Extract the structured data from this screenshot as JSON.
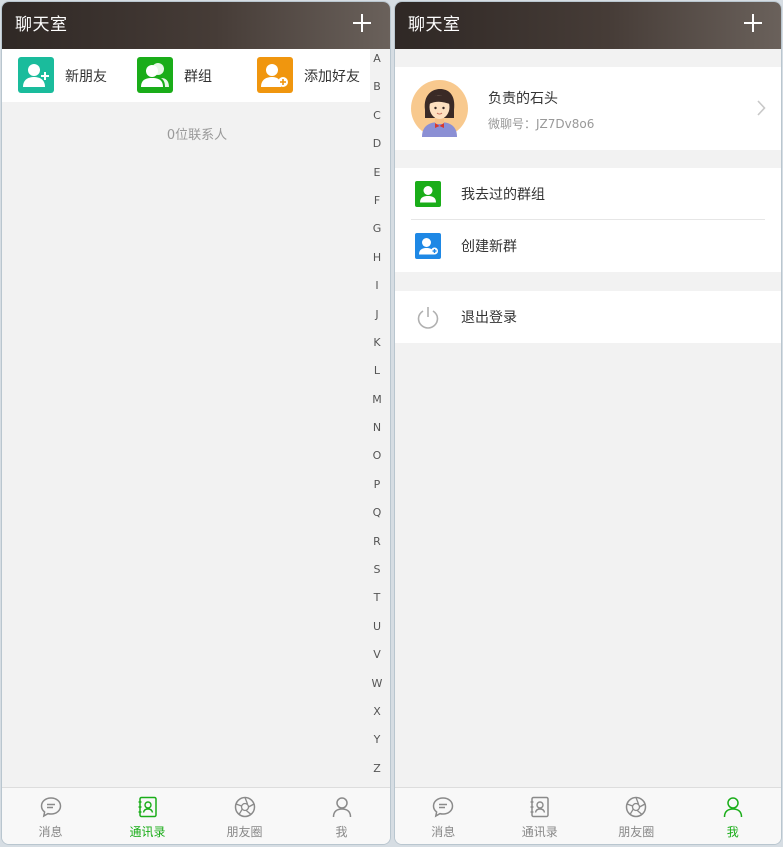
{
  "left": {
    "header": {
      "title": "聊天室"
    },
    "quickbar": {
      "items": [
        {
          "label": "新朋友",
          "color": "#1abc9c",
          "icon": "new-friend-icon"
        },
        {
          "label": "群组",
          "color": "#1aad19",
          "icon": "group-icon"
        },
        {
          "label": "添加好友",
          "color": "#f0960e",
          "icon": "add-friend-icon"
        }
      ]
    },
    "contacts_count": "0位联系人",
    "alphabet": [
      "A",
      "B",
      "C",
      "D",
      "E",
      "F",
      "G",
      "H",
      "I",
      "J",
      "K",
      "L",
      "M",
      "N",
      "O",
      "P",
      "Q",
      "R",
      "S",
      "T",
      "U",
      "V",
      "W",
      "X",
      "Y",
      "Z"
    ],
    "tabs": [
      {
        "label": "消息",
        "icon": "chat-bubble-icon",
        "active": false
      },
      {
        "label": "通讯录",
        "icon": "contacts-book-icon",
        "active": true
      },
      {
        "label": "朋友圈",
        "icon": "aperture-icon",
        "active": false
      },
      {
        "label": "我",
        "icon": "person-icon",
        "active": false
      }
    ]
  },
  "right": {
    "header": {
      "title": "聊天室"
    },
    "profile": {
      "name": "负责的石头",
      "wechat_id": "微聊号：JZ7Dv8o6"
    },
    "menu": [
      {
        "label": "我去过的群组",
        "color": "#1aad19",
        "icon": "group-history-icon"
      },
      {
        "label": "创建新群",
        "color": "#1e88e5",
        "icon": "create-group-icon"
      }
    ],
    "logout": {
      "label": "退出登录",
      "icon": "power-icon"
    },
    "tabs": [
      {
        "label": "消息",
        "icon": "chat-bubble-icon",
        "active": false
      },
      {
        "label": "通讯录",
        "icon": "contacts-book-icon",
        "active": false
      },
      {
        "label": "朋友圈",
        "icon": "aperture-icon",
        "active": false
      },
      {
        "label": "我",
        "icon": "person-icon",
        "active": true
      }
    ]
  },
  "colors": {
    "accent": "#1aad19",
    "header_dark": "#2f2825",
    "background": "#f2f2f2",
    "muted_text": "#999999"
  }
}
